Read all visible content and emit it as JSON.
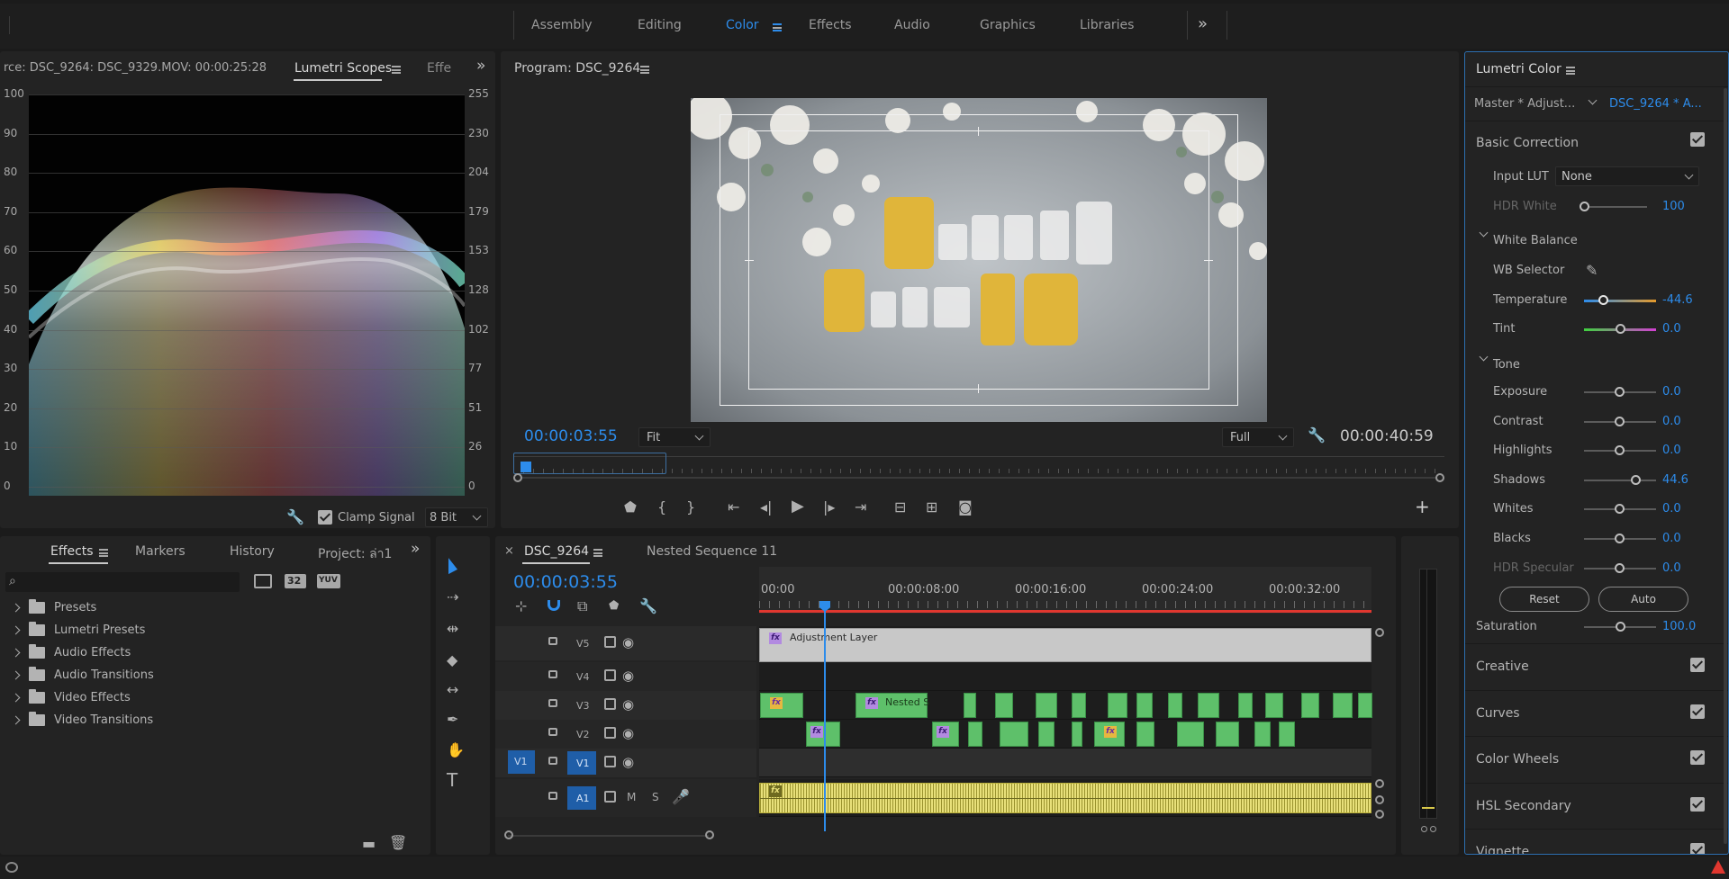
{
  "workspaces": {
    "items": [
      "Assembly",
      "Editing",
      "Color",
      "Effects",
      "Audio",
      "Graphics",
      "Libraries"
    ],
    "active": "Color",
    "overflow": "»"
  },
  "scopes_panel": {
    "source_tab": "rce: DSC_9264: DSC_9329.MOV: 00:00:25:28",
    "active_tab": "Lumetri Scopes",
    "next_tab": "Effe",
    "left_scale": [
      "100",
      "90",
      "80",
      "70",
      "60",
      "50",
      "40",
      "30",
      "20",
      "10",
      "0"
    ],
    "right_scale": [
      "255",
      "230",
      "204",
      "179",
      "153",
      "128",
      "102",
      "77",
      "51",
      "26",
      "0"
    ],
    "clamp_label": "Clamp Signal",
    "bit_depth": "8 Bit"
  },
  "program_panel": {
    "title": "Program: DSC_9264",
    "timecode": "00:00:03:55",
    "fit": "Fit",
    "quality": "Full",
    "duration": "00:00:40:59"
  },
  "lumetri_color": {
    "title": "Lumetri Color",
    "master_clip": "Master * Adjust...",
    "active_clip": "DSC_9264 * A...",
    "basic_correction": "Basic Correction",
    "input_lut_label": "Input LUT",
    "input_lut_value": "None",
    "hdr_white_label": "HDR White",
    "hdr_white_value": "100",
    "white_balance": "White Balance",
    "wb_selector": "WB Selector",
    "temperature_label": "Temperature",
    "temperature_value": "-44.6",
    "tint_label": "Tint",
    "tint_value": "0.0",
    "tone": "Tone",
    "tone_controls": [
      {
        "label": "Exposure",
        "value": "0.0",
        "level": 0.5
      },
      {
        "label": "Contrast",
        "value": "0.0",
        "level": 0.5
      },
      {
        "label": "Highlights",
        "value": "0.0",
        "level": 0.5
      },
      {
        "label": "Shadows",
        "value": "44.6",
        "level": 0.72
      },
      {
        "label": "Whites",
        "value": "0.0",
        "level": 0.5
      },
      {
        "label": "Blacks",
        "value": "0.0",
        "level": 0.5
      },
      {
        "label": "HDR Specular",
        "value": "0.0",
        "level": 0.5
      }
    ],
    "reset_label": "Reset",
    "auto_label": "Auto",
    "saturation_label": "Saturation",
    "saturation_value": "100.0",
    "sections": [
      "Creative",
      "Curves",
      "Color Wheels",
      "HSL Secondary",
      "Vignette"
    ]
  },
  "effects_panel": {
    "tabs": [
      "Effects",
      "Markers",
      "History",
      "Project: ล่า1"
    ],
    "active_tab": "Effects",
    "badges": [
      "32",
      "YUV"
    ],
    "tree": [
      "Presets",
      "Lumetri Presets",
      "Audio Effects",
      "Audio Transitions",
      "Video Effects",
      "Video Transitions"
    ]
  },
  "timeline": {
    "tabs": [
      "DSC_9264",
      "Nested Sequence 11"
    ],
    "timecode": "00:00:03:55",
    "ruler": [
      "00:00",
      "00:00:08:00",
      "00:00:16:00",
      "00:00:24:00",
      "00:00:32:00"
    ],
    "tracks": [
      {
        "name": "V5"
      },
      {
        "name": "V4"
      },
      {
        "name": "V3"
      },
      {
        "name": "V2"
      },
      {
        "name": "V1",
        "source": "V1"
      },
      {
        "name": "A1",
        "m": "M",
        "s": "S"
      }
    ],
    "adjustment_layer": "Adjustment Layer",
    "nested_clip": "Nested S"
  },
  "colors": {
    "accent_blue": "#2d8ceb",
    "clip_green": "#5ec06a",
    "audio_yellow": "#e8e07a",
    "playhead_red": "#e0372f"
  }
}
